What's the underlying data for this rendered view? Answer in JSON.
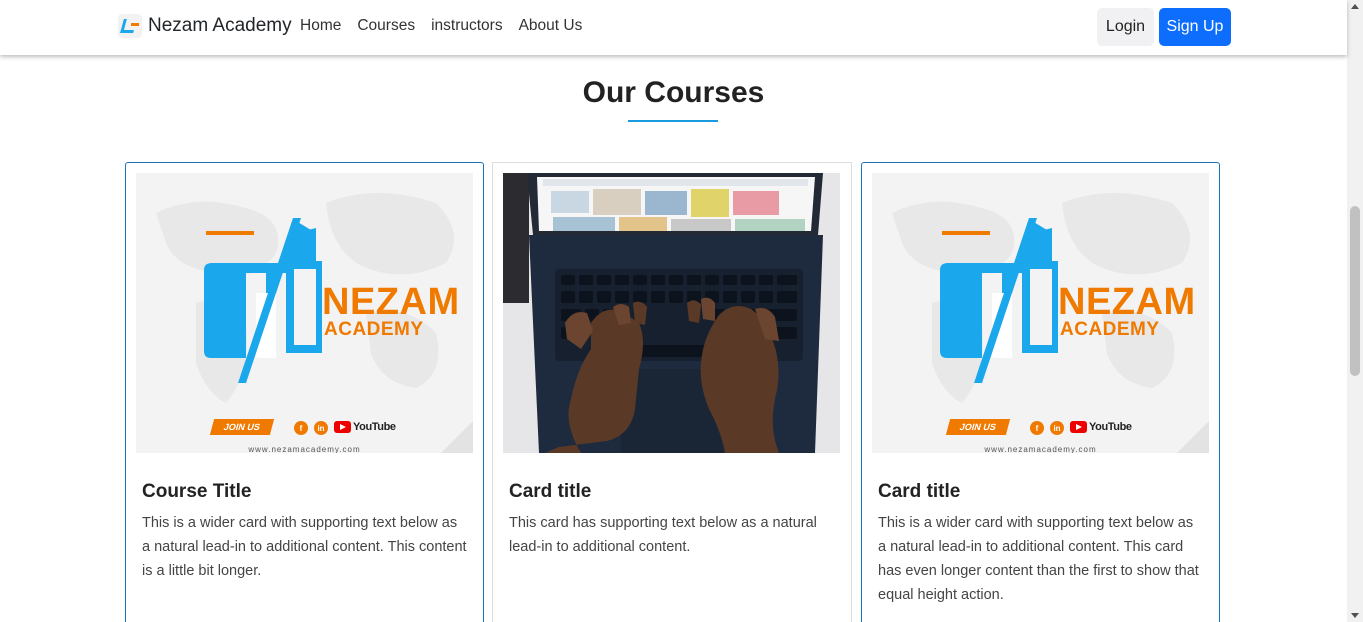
{
  "navbar": {
    "brand": "Nezam Academy",
    "links": [
      "Home",
      "Courses",
      "instructors",
      "About Us"
    ],
    "login_label": "Login",
    "signup_label": "Sign Up"
  },
  "section": {
    "title": "Our Courses"
  },
  "promo_image": {
    "word1": "NEZAM",
    "word2": "ACADEMY",
    "join": "JOIN US",
    "social_icons": [
      "facebook-icon",
      "linkedin-icon",
      "youtube-icon"
    ],
    "youtube_text": "YouTube",
    "url": "www.nezamacademy.com"
  },
  "cards": [
    {
      "image": "nezam-academy-promo",
      "title": "Course Title",
      "text": "This is a wider card with supporting text below as a natural lead-in to additional content. This content is a little bit longer."
    },
    {
      "image": "laptop-typing-photo",
      "title": "Card title",
      "text": "This card has supporting text below as a natural lead-in to additional content."
    },
    {
      "image": "nezam-academy-promo",
      "title": "Card title",
      "text": "This is a wider card with supporting text below as a natural lead-in to additional content. This card has even longer content than the first to show that equal height action."
    }
  ],
  "colors": {
    "primary": "#0d6efd",
    "accent_underline": "#1a9be0",
    "brand_orange": "#f07a00",
    "brand_blue": "#1aa7ec",
    "card_border": "#1b72b8"
  }
}
